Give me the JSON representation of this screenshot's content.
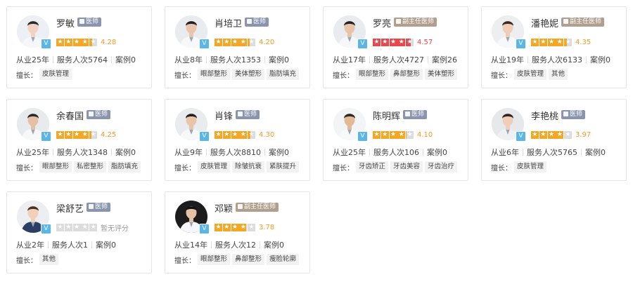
{
  "labels": {
    "specialty_prefix": "擅长：",
    "no_rating": "暂无评分",
    "verified_mark": "V"
  },
  "colors": {
    "star_orange": "#f5a623",
    "star_red": "#e8474c",
    "score_orange": "#f59a23",
    "tag_doctor_bg": "#8a95ad",
    "tag_deputy_bg": "#b09f8d",
    "verified_blue": "#59b6e6"
  },
  "doctors": [
    {
      "name": "罗敏",
      "title": "医师",
      "title_kind": "yishi",
      "rating": 4.28,
      "score_text": "4.28",
      "star_color": "orange",
      "years": "从业25年",
      "served": "服务人次5764",
      "cases": "案例0",
      "specialties": [
        "皮肤管理"
      ],
      "avatar": {
        "bg": "#eceff3",
        "hair": "#2b2b2b",
        "coat": "#f5f7fa",
        "skin": "#f2d3c2"
      }
    },
    {
      "name": "肖培卫",
      "title": "医师",
      "title_kind": "yishi",
      "rating": 4.2,
      "score_text": "4.20",
      "star_color": "orange",
      "years": "从业8年",
      "served": "服务人次1353",
      "cases": "案例0",
      "specialties": [
        "眼部整形",
        "美体塑形",
        "脂肪填充"
      ],
      "avatar": {
        "bg": "#e9ecef",
        "hair": "#1f1f1f",
        "coat": "#f7f8fa",
        "skin": "#e9c5ab"
      }
    },
    {
      "name": "罗亮",
      "title": "副主任医师",
      "title_kind": "fuzhuren",
      "rating": 4.57,
      "score_text": "4.57",
      "star_color": "red",
      "years": "从业17年",
      "served": "服务人次4727",
      "cases": "案例26",
      "specialties": [
        "眼部整形",
        "鼻部整形",
        "美体塑形"
      ],
      "avatar": {
        "bg": "#e9ecef",
        "hair": "#222222",
        "coat": "#f5f7fa",
        "skin": "#e8c3a8"
      }
    },
    {
      "name": "潘艳妮",
      "title": "副主任医师",
      "title_kind": "fuzhuren",
      "rating": 4.35,
      "score_text": "4.35",
      "star_color": "orange",
      "years": "从业19年",
      "served": "服务人次6133",
      "cases": "案例0",
      "specialties": [
        "皮肤管理",
        "其他"
      ],
      "avatar": {
        "bg": "#edeef0",
        "hair": "#3a2a22",
        "coat": "#f7f8fa",
        "skin": "#f0cdb7"
      }
    },
    {
      "name": "余春国",
      "title": "医师",
      "title_kind": "yishi",
      "rating": 4.25,
      "score_text": "4.25",
      "star_color": "orange",
      "years": "从业25年",
      "served": "服务人次1348",
      "cases": "案例0",
      "specialties": [
        "眼部整形",
        "私密整形",
        "脂肪填充"
      ],
      "avatar": {
        "bg": "#e8ebee",
        "hair": "#2a2a2a",
        "coat": "#f7f8fa",
        "skin": "#e6c0a4"
      }
    },
    {
      "name": "肖锋",
      "title": "医师",
      "title_kind": "yishi",
      "rating": 4.3,
      "score_text": "4.30",
      "star_color": "orange",
      "years": "从业9年",
      "served": "服务人次8810",
      "cases": "案例0",
      "specialties": [
        "皮肤管理",
        "除皱抗衰",
        "紧肤提升"
      ],
      "avatar": {
        "bg": "#e9ecef",
        "hair": "#202020",
        "coat": "#f7f8fa",
        "skin": "#e8c4aa"
      }
    },
    {
      "name": "陈明辉",
      "title": "医师",
      "title_kind": "yishi",
      "rating": 4.1,
      "score_text": "4.10",
      "star_color": "orange",
      "years": "从业25年",
      "served": "服务人次106",
      "cases": "案例0",
      "specialties": [
        "牙齿矫正",
        "牙齿美容",
        "牙齿治疗"
      ],
      "avatar": {
        "bg": "#f3f4f6",
        "hair": "#2a2a2a",
        "coat": "#f7f8fa",
        "skin": "#e3b996"
      }
    },
    {
      "name": "李艳桃",
      "title": "医师",
      "title_kind": "yishi",
      "rating": 3.97,
      "score_text": "3.97",
      "star_color": "orange",
      "years": "从业6年",
      "served": "服务人次5765",
      "cases": "案例0",
      "specialties": [
        "皮肤管理"
      ],
      "avatar": {
        "bg": "#e6e8eb",
        "hair": "#2f2520",
        "coat": "#eef0f3",
        "skin": "#efcdb8"
      }
    },
    {
      "name": "梁舒艺",
      "title": "医师",
      "title_kind": "yishi",
      "rating": 0,
      "score_text": "暂无评分",
      "star_color": "none",
      "years": "从业2年",
      "served": "服务人次1",
      "cases": "案例0",
      "specialties": [
        "其他"
      ],
      "avatar": {
        "bg": "#eceef1",
        "hair": "#4a3222",
        "coat": "#2c3e64",
        "skin": "#f1cfb9"
      }
    },
    {
      "name": "邓颖",
      "title": "副主任医师",
      "title_kind": "fuzhuren",
      "rating": 3.78,
      "score_text": "3.78",
      "star_color": "orange",
      "years": "从业14年",
      "served": "服务人次12",
      "cases": "案例0",
      "specialties": [
        "眼部整形",
        "鼻部整形",
        "瘦脸轮廓"
      ],
      "avatar": {
        "bg": "#1c1c1c",
        "hair": "#111111",
        "coat": "#f5f7fa",
        "skin": "#e7c1a6"
      }
    }
  ]
}
